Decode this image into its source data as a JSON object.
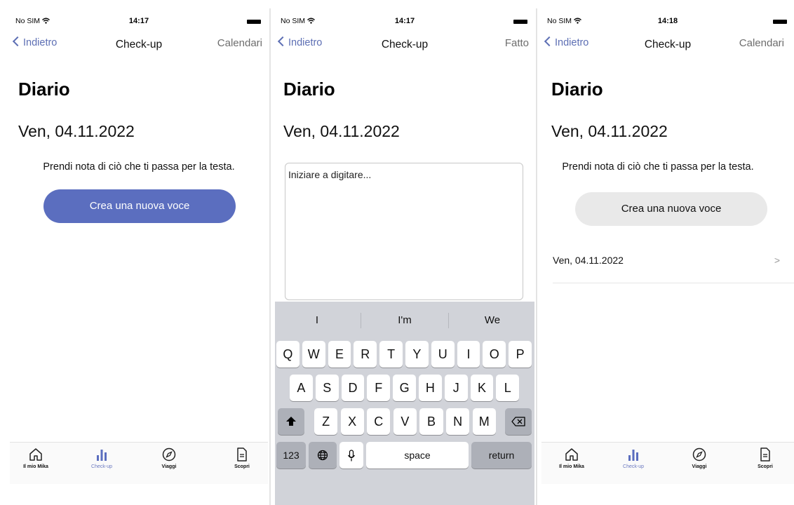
{
  "status": {
    "carrier": "No SIM",
    "time_1": "14:17",
    "time_2": "14:17",
    "time_3": "14:18"
  },
  "nav": {
    "back": "Indietro",
    "title": "Check-up",
    "right_calendar": "Calendari",
    "right_done": "Fatto"
  },
  "diary": {
    "heading": "Diario",
    "date": "Ven, 04.11.2022",
    "prompt": "Prendi nota di ciò che ti passa per la testa.",
    "create_button": "Crea una nuova voce",
    "placeholder": "Iniziare a digitare...",
    "entries": [
      {
        "date": "Ven, 04.11.2022",
        "chevron": ">"
      }
    ]
  },
  "tabs": [
    {
      "label": "Il mio Mika",
      "icon": "home-icon"
    },
    {
      "label": "Check-up",
      "icon": "bar-chart-icon",
      "active": true
    },
    {
      "label": "Viaggi",
      "icon": "compass-icon"
    },
    {
      "label": "Scopri",
      "icon": "document-icon"
    }
  ],
  "keyboard": {
    "suggestions": [
      "I",
      "I'm",
      "We"
    ],
    "row1": [
      "Q",
      "W",
      "E",
      "R",
      "T",
      "Y",
      "U",
      "I",
      "O",
      "P"
    ],
    "row2": [
      "A",
      "S",
      "D",
      "F",
      "G",
      "H",
      "J",
      "K",
      "L"
    ],
    "row3": [
      "Z",
      "X",
      "C",
      "V",
      "B",
      "N",
      "M"
    ],
    "numbers": "123",
    "space": "space",
    "return": "return"
  },
  "colors": {
    "accent": "#5b6ebf",
    "nav_link": "#5d6fb4",
    "keyboard_bg": "#d1d3d9"
  }
}
